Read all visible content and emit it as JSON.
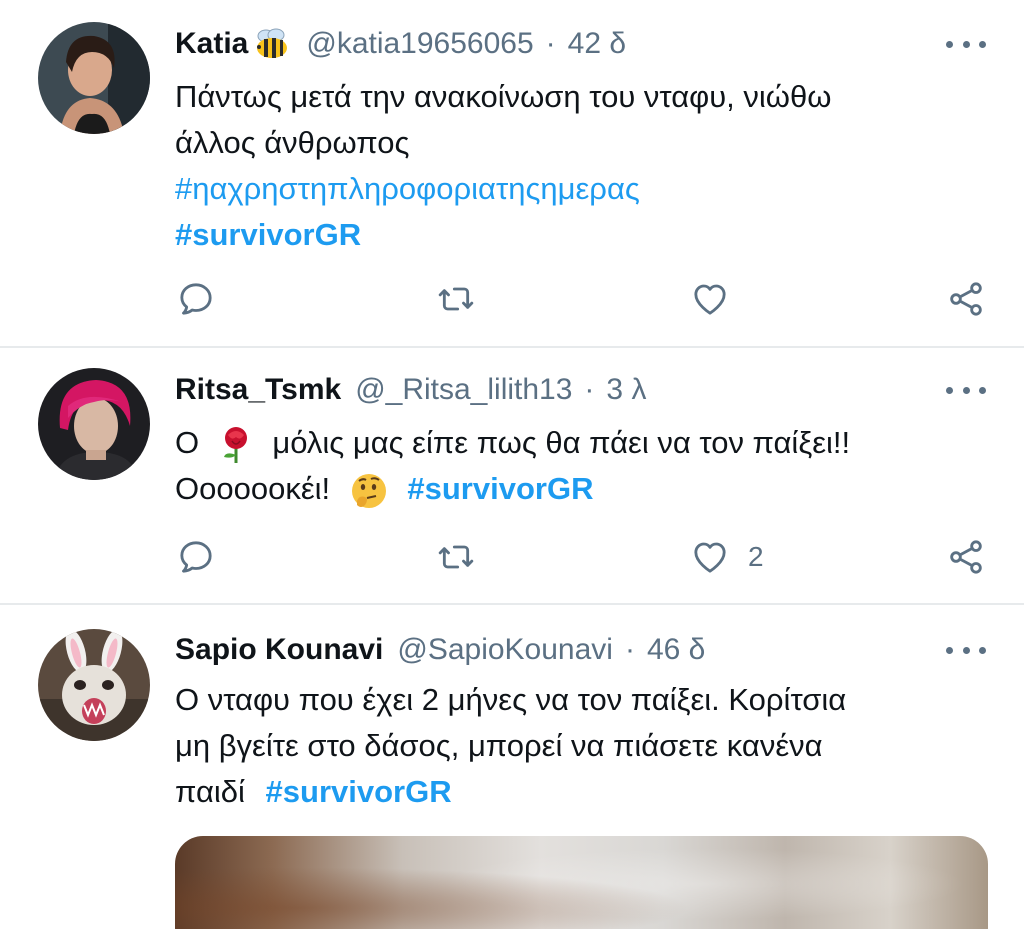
{
  "tweets": [
    {
      "name": "Katia",
      "name_emoji": "bee-emoji",
      "handle": "@katia19656065",
      "time": "42 δ",
      "line1": "Πάντως μετά την ανακοίνωση του νταφυ, νιώθω",
      "line2": "άλλος άνθρωπος",
      "hashtag1": "#ηαχρηστηπληροφοριατηςημερας",
      "hashtag2": "#survivorGR",
      "likes": ""
    },
    {
      "name": "Ritsa_Tsmk",
      "handle": "@_Ritsa_lilith13",
      "time": "3 λ",
      "line1_pre": "Ο",
      "rose_emoji": "rose-emoji",
      "line1_post": "μόλις μας είπε πως θα πάει να τον παίξει!!",
      "line2": "Οοοοοοκέι!",
      "thinking_emoji": "thinking-face-emoji",
      "hashtag": "#survivorGR",
      "likes": "2"
    },
    {
      "name": "Sapio Kounavi",
      "handle": "@SapioKounavi",
      "time": "46 δ",
      "line1": "Ο νταφυ που έχει 2 μήνες να τον παίξει. Κορίτσια",
      "line2": "μη βγείτε στο δάσος, μπορεί να πιάσετε κανένα",
      "line3": "παιδί",
      "hashtag": "#survivorGR"
    }
  ],
  "separator": "·",
  "icons": {
    "reply": "reply-icon",
    "retweet": "retweet-icon",
    "like": "heart-icon",
    "share": "share-icon",
    "more": "more-icon"
  },
  "colors": {
    "link": "#1d9bf0",
    "secondary": "#5b7083",
    "text": "#0f1419",
    "divider": "#e7eaec"
  }
}
